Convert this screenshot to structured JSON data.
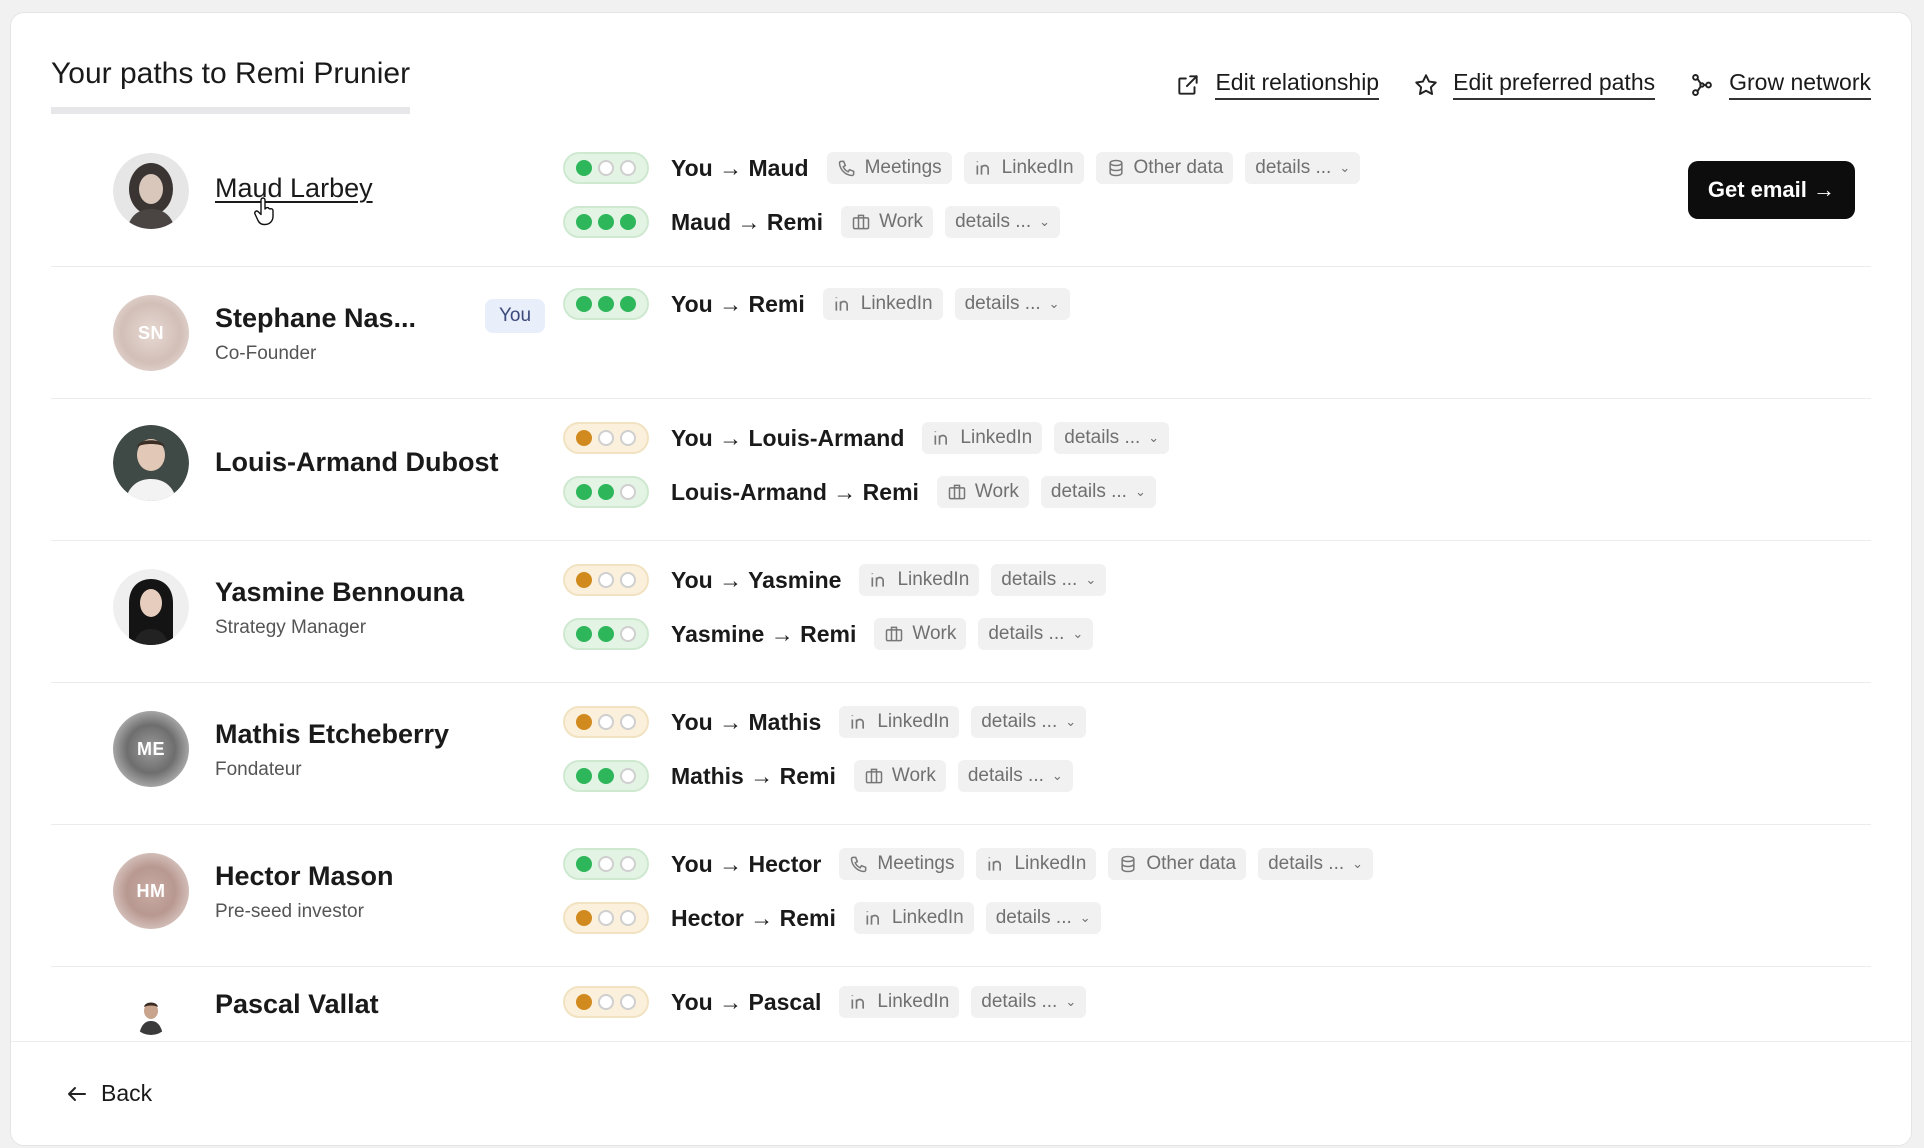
{
  "header": {
    "title": "Your paths to Remi Prunier",
    "actions": [
      {
        "label": "Edit relationship",
        "icon": "external-link-icon"
      },
      {
        "label": "Edit preferred paths",
        "icon": "star-icon"
      },
      {
        "label": "Grow network",
        "icon": "network-icon"
      }
    ]
  },
  "colors": {
    "green": "#2eb65a",
    "orange": "#d18a1e",
    "button": "#0d0d0d",
    "badge_bg": "#e9eefb"
  },
  "rows": [
    {
      "name": "Maud Larbey",
      "subtitle": "",
      "avatar": "photo",
      "paths": [
        {
          "label": "You → Maud",
          "strength": 1,
          "level": "green",
          "tags": [
            "Meetings",
            "LinkedIn",
            "Other data"
          ],
          "details": "details ..."
        },
        {
          "label": "Maud → Remi",
          "strength": 3,
          "level": "green",
          "tags": [
            "Work"
          ],
          "details": "details ..."
        }
      ]
    },
    {
      "name": "Stephane Nas...",
      "subtitle": "Co-Founder",
      "badge": "You",
      "avatar_initials": "SN",
      "paths": [
        {
          "label": "You → Remi",
          "strength": 3,
          "level": "green",
          "tags": [
            "LinkedIn"
          ],
          "details": "details ..."
        }
      ],
      "button": "Get email →"
    },
    {
      "name": "Louis-Armand Dubost",
      "subtitle": "",
      "avatar": "photo",
      "paths": [
        {
          "label": "You → Louis-Armand",
          "strength": 1,
          "level": "orange",
          "tags": [
            "LinkedIn"
          ],
          "details": "details ..."
        },
        {
          "label": "Louis-Armand → Remi",
          "strength": 2,
          "level": "green",
          "tags": [
            "Work"
          ],
          "details": "details ..."
        }
      ]
    },
    {
      "name": "Yasmine Bennouna",
      "subtitle": "Strategy Manager",
      "avatar": "photo",
      "paths": [
        {
          "label": "You → Yasmine",
          "strength": 1,
          "level": "orange",
          "tags": [
            "LinkedIn"
          ],
          "details": "details ..."
        },
        {
          "label": "Yasmine → Remi",
          "strength": 2,
          "level": "green",
          "tags": [
            "Work"
          ],
          "details": "details ..."
        }
      ]
    },
    {
      "name": "Mathis Etcheberry",
      "subtitle": "Fondateur",
      "avatar_initials": "ME",
      "paths": [
        {
          "label": "You → Mathis",
          "strength": 1,
          "level": "orange",
          "tags": [
            "LinkedIn"
          ],
          "details": "details ..."
        },
        {
          "label": "Mathis → Remi",
          "strength": 2,
          "level": "green",
          "tags": [
            "Work"
          ],
          "details": "details ..."
        }
      ]
    },
    {
      "name": "Hector Mason",
      "subtitle": "Pre-seed investor",
      "avatar_initials": "HM",
      "paths": [
        {
          "label": "You → Hector",
          "strength": 1,
          "level": "green",
          "tags": [
            "Meetings",
            "LinkedIn",
            "Other data"
          ],
          "details": "details ..."
        },
        {
          "label": "Hector → Remi",
          "strength": 1,
          "level": "orange",
          "tags": [
            "LinkedIn"
          ],
          "details": "details ..."
        }
      ]
    },
    {
      "name": "Pascal Vallat",
      "subtitle": "",
      "avatar": "photo",
      "paths": [
        {
          "label": "You → Pascal",
          "strength": 1,
          "level": "orange",
          "tags": [
            "LinkedIn"
          ],
          "details": "details ..."
        }
      ]
    }
  ],
  "footer": {
    "back_label": "Back"
  }
}
